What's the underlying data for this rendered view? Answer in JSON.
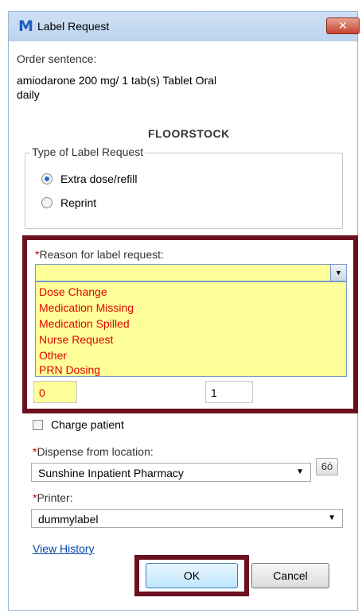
{
  "window": {
    "title": "Label Request",
    "icon_letter": "M",
    "close_glyph": "✕"
  },
  "order": {
    "label": "Order sentence:",
    "line1": "amiodarone 200 mg/ 1 tab(s) Tablet Oral",
    "line2": "daily"
  },
  "location_type": "FLOORSTOCK",
  "label_type": {
    "legend": "Type of Label Request",
    "options": [
      {
        "label": "Extra dose/refill",
        "selected": true
      },
      {
        "label": "Reprint",
        "selected": false
      }
    ]
  },
  "reason": {
    "required_mark": "*",
    "label": "Reason for label request:",
    "value": "",
    "options": [
      "Dose Change",
      "Medication Missing",
      "Medication Spilled",
      "Nurse Request",
      "Other",
      "PRN Dosing"
    ]
  },
  "quantity": {
    "value": "0"
  },
  "count": {
    "value": "1"
  },
  "charge": {
    "label": "Charge patient",
    "checked": false
  },
  "dispense": {
    "required_mark": "*",
    "label": "Dispense from location:",
    "value": "Sunshine Inpatient Pharmacy"
  },
  "printer": {
    "required_mark": "*",
    "label": "Printer:",
    "value": "dummylabel"
  },
  "history_link": "View History",
  "buttons": {
    "ok": "OK",
    "cancel": "Cancel"
  },
  "colors": {
    "highlight": "#6b1020",
    "required_field": "#ffff99",
    "option_text": "#e00000"
  }
}
